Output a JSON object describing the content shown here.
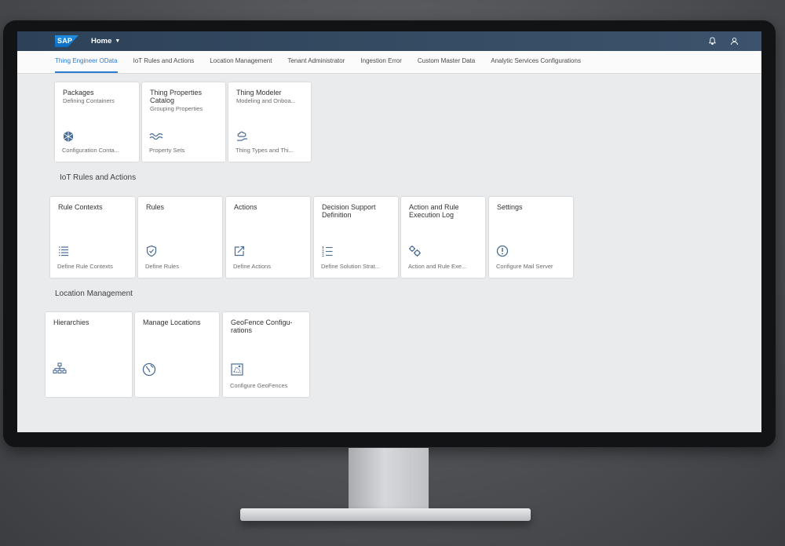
{
  "shell": {
    "logo": "SAP",
    "home_label": "Home"
  },
  "tabs": [
    {
      "label": "Thing Engineer OData",
      "active": true
    },
    {
      "label": "IoT Rules and Actions",
      "active": false
    },
    {
      "label": "Location Management",
      "active": false
    },
    {
      "label": "Tenant Administrator",
      "active": false
    },
    {
      "label": "Ingestion Error",
      "active": false
    },
    {
      "label": "Custom Master Data",
      "active": false
    },
    {
      "label": "Analytic Services Configurations",
      "active": false
    }
  ],
  "group1": {
    "tiles": [
      {
        "title": "Packages",
        "subtitle": "Defining Containers",
        "icon": "cube-icon",
        "footer": "Configuration Conta..."
      },
      {
        "title": "Thing Properties Catalog",
        "subtitle": "Grouping Properties",
        "icon": "wave-icon",
        "footer": "Property Sets"
      },
      {
        "title": "Thing Modeler",
        "subtitle": "Modeling and Onboa...",
        "icon": "hand-cloud-icon",
        "footer": "Thing Types and Thi..."
      }
    ]
  },
  "group2": {
    "title": "IoT Rules and Actions",
    "tiles": [
      {
        "title": "Rule Contexts",
        "icon": "list-icon",
        "footer": "Define Rule Contexts"
      },
      {
        "title": "Rules",
        "icon": "shield-icon",
        "footer": "Define Rules"
      },
      {
        "title": "Actions",
        "icon": "share-icon",
        "footer": "Define Actions"
      },
      {
        "title": "Decision Support Definition",
        "icon": "numbered-list-icon",
        "footer": "Define Solution Strat..."
      },
      {
        "title": "Action and Rule Execution Log",
        "icon": "gears-icon",
        "footer": "Action and Rule Exe..."
      },
      {
        "title": "Settings",
        "icon": "alert-icon",
        "footer": "Configure Mail Server"
      }
    ]
  },
  "group3": {
    "title": "Location Management",
    "tiles": [
      {
        "title": "Hierarchies",
        "icon": "hierarchy-icon",
        "footer": ""
      },
      {
        "title": "Manage Locations",
        "icon": "globe-icon",
        "footer": ""
      },
      {
        "title": "GeoFence Configu-rations",
        "icon": "geofence-icon",
        "footer": "Configure GeoFences"
      }
    ]
  },
  "colors": {
    "accent": "#2b7bd0",
    "shell": "#2d4258",
    "icon": "#4a6d96"
  }
}
